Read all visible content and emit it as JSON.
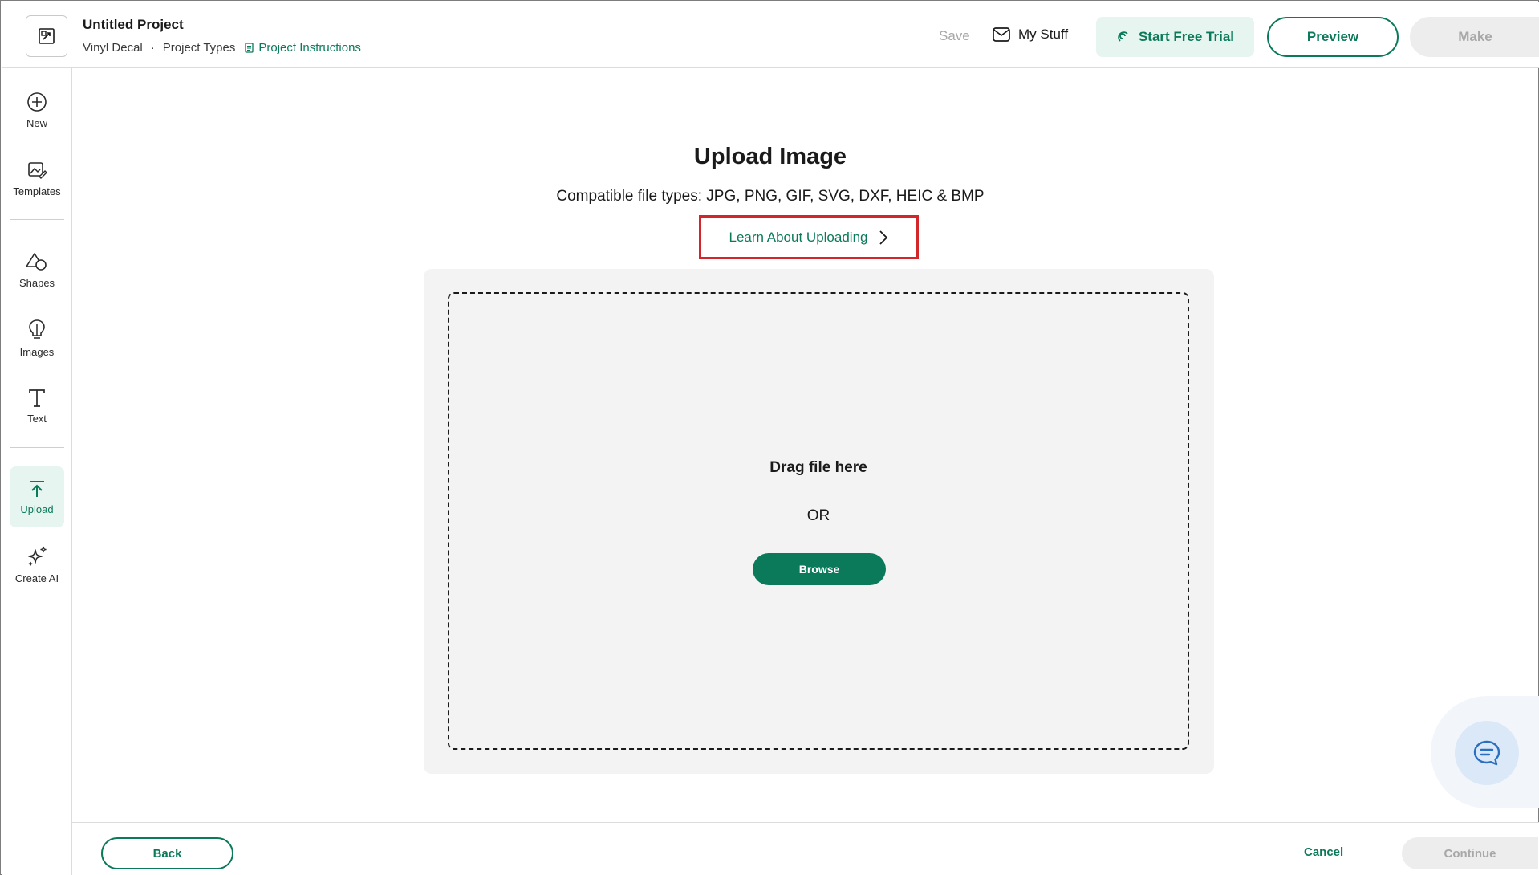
{
  "header": {
    "project_title": "Untitled Project",
    "project_type": "Vinyl Decal",
    "meta_separator": "·",
    "project_types_link": "Project Types",
    "project_instructions_link": "Project Instructions",
    "save_label": "Save",
    "my_stuff_label": "My Stuff",
    "start_trial_label": "Start Free Trial",
    "preview_label": "Preview",
    "make_label": "Make"
  },
  "sidebar": {
    "items": [
      {
        "label": "New",
        "icon": "plus-circle-icon"
      },
      {
        "label": "Templates",
        "icon": "template-icon"
      },
      {
        "label": "Shapes",
        "icon": "shapes-icon"
      },
      {
        "label": "Images",
        "icon": "lightbulb-icon"
      },
      {
        "label": "Text",
        "icon": "text-icon"
      },
      {
        "label": "Upload",
        "icon": "upload-icon",
        "active": true
      },
      {
        "label": "Create AI",
        "icon": "sparkle-icon"
      }
    ]
  },
  "main": {
    "title": "Upload Image",
    "compatible_types": "Compatible file types:  JPG, PNG, GIF, SVG, DXF, HEIC & BMP",
    "learn_link": "Learn About Uploading",
    "drag_text": "Drag file here",
    "or_text": "OR",
    "browse_label": "Browse"
  },
  "footer": {
    "back_label": "Back",
    "cancel_label": "Cancel",
    "continue_label": "Continue"
  },
  "colors": {
    "accent": "#0b7a5a",
    "accent_light": "#e6f5ef",
    "highlight_box": "#d3262b",
    "disabled": "#a8a8a8"
  }
}
